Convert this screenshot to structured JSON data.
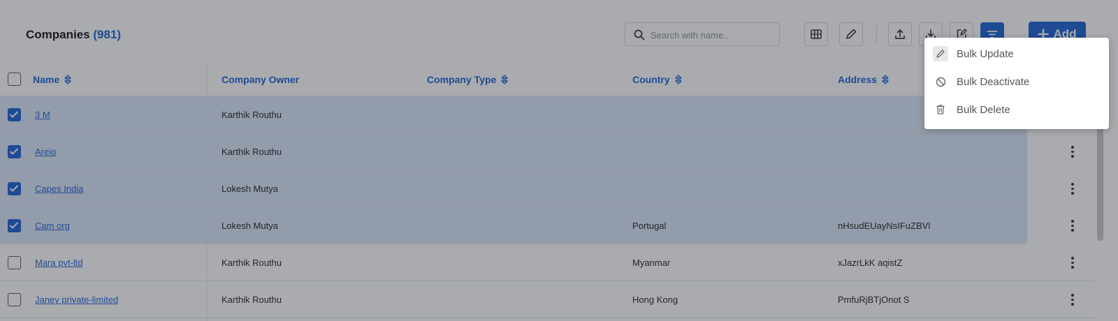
{
  "header": {
    "title": "Companies",
    "count": "(981)",
    "search_placeholder": "Search with name..",
    "add_label": "Add"
  },
  "table": {
    "columns": [
      "Name",
      "Company Owner",
      "Company Type",
      "Country",
      "Address"
    ],
    "rows": [
      {
        "name": "3 M",
        "owner": "Karthik Routhu",
        "type": "",
        "country": "",
        "address": "",
        "selected": true
      },
      {
        "name": "Areio",
        "owner": "Karthik Routhu",
        "type": "",
        "country": "",
        "address": "",
        "selected": true
      },
      {
        "name": "Capes India",
        "owner": "Lokesh Mutya",
        "type": "",
        "country": "",
        "address": "",
        "selected": true
      },
      {
        "name": "Cam org",
        "owner": "Lokesh Mutya",
        "type": "",
        "country": "Portugal",
        "address": "nHsudEUayNsIFuZBVl",
        "selected": true
      },
      {
        "name": "Mara pvt-ltd",
        "owner": "Karthik Routhu",
        "type": "",
        "country": "Myanmar",
        "address": "xJazrLkK aqistZ",
        "selected": false
      },
      {
        "name": "Janey private-limited",
        "owner": "Karthik Routhu",
        "type": "",
        "country": "Hong Kong",
        "address": "PmfuRjBTjOnot S",
        "selected": false
      }
    ]
  },
  "bulk_menu": {
    "items": [
      {
        "label": "Bulk Update",
        "icon": "pencil-icon"
      },
      {
        "label": "Bulk Deactivate",
        "icon": "block-icon"
      },
      {
        "label": "Bulk Delete",
        "icon": "trash-icon"
      }
    ]
  },
  "colors": {
    "accent": "#1a5fd6",
    "selected_row": "#dbe7f8",
    "overlay": "rgba(40,44,52,0.40)"
  }
}
